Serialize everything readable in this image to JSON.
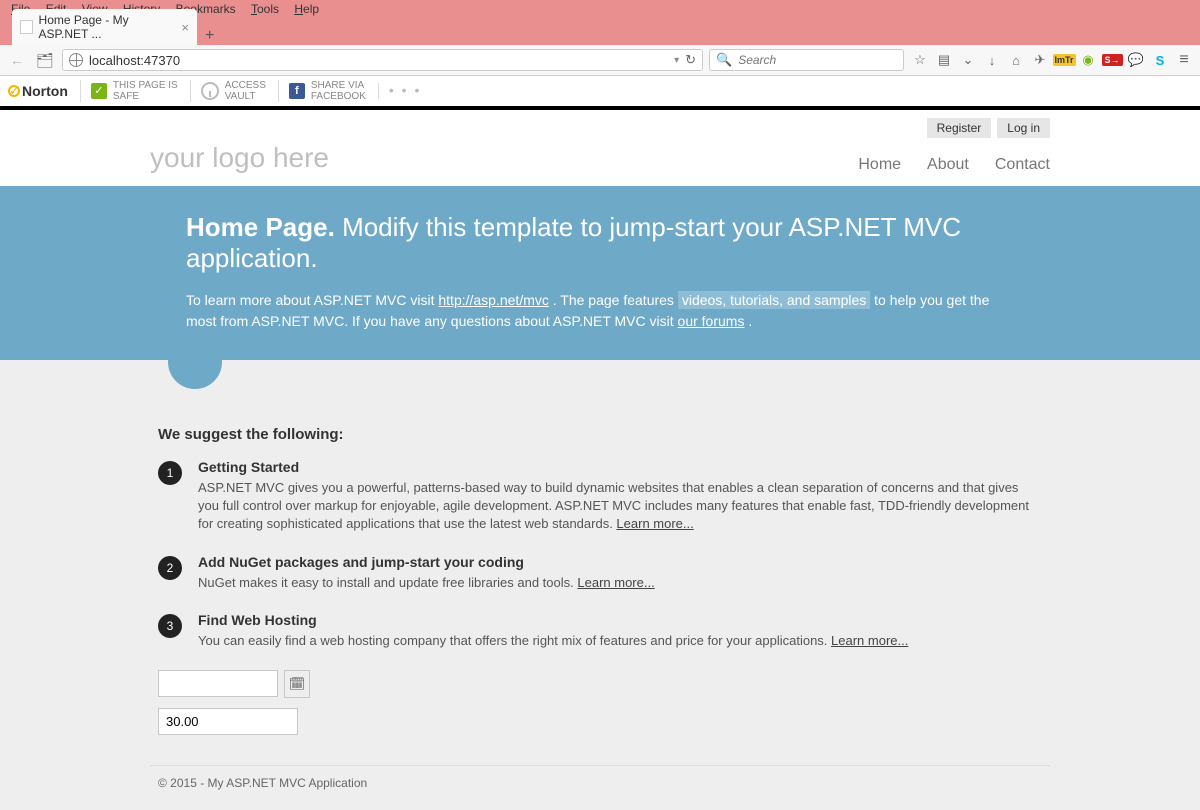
{
  "menubar": {
    "file": "File",
    "edit": "Edit",
    "view": "View",
    "history": "History",
    "bookmarks": "Bookmarks",
    "tools": "Tools",
    "help": "Help"
  },
  "tab": {
    "title": "Home Page - My ASP.NET ..."
  },
  "url": {
    "host": "localhost:",
    "port": "47370"
  },
  "search": {
    "placeholder": "Search"
  },
  "norton": {
    "brand": "Norton",
    "safe_t": "THIS PAGE IS",
    "safe_b": "SAFE",
    "vault_t": "ACCESS",
    "vault_b": "VAULT",
    "fb_t": "SHARE VIA",
    "fb_b": "FACEBOOK"
  },
  "auth": {
    "register": "Register",
    "login": "Log in"
  },
  "logo": "your logo here",
  "nav": {
    "home": "Home",
    "about": "About",
    "contact": "Contact"
  },
  "hero": {
    "title_strong": "Home Page.",
    "title_rest": "Modify this template to jump-start your ASP.NET MVC application.",
    "p1_a": "To learn more about ASP.NET MVC visit ",
    "p1_link1": "http://asp.net/mvc",
    "p1_b": ". The page features ",
    "p1_link2": "videos, tutorials, and samples",
    "p1_c": " to help you get the most from ASP.NET MVC. If you have any questions about ASP.NET MVC visit ",
    "p1_link3": "our forums",
    "p1_d": "."
  },
  "suggest_title": "We suggest the following:",
  "items": [
    {
      "n": "1",
      "h": "Getting Started",
      "p": "ASP.NET MVC gives you a powerful, patterns-based way to build dynamic websites that enables a clean separation of concerns and that gives you full control over markup for enjoyable, agile development. ASP.NET MVC includes many features that enable fast, TDD-friendly development for creating sophisticated applications that use the latest web standards. ",
      "more": "Learn more..."
    },
    {
      "n": "2",
      "h": "Add NuGet packages and jump-start your coding",
      "p": "NuGet makes it easy to install and update free libraries and tools. ",
      "more": "Learn more..."
    },
    {
      "n": "3",
      "h": "Find Web Hosting",
      "p": "You can easily find a web hosting company that offers the right mix of features and price for your applications. ",
      "more": "Learn more..."
    }
  ],
  "num_input": "30.00",
  "footer": "© 2015 - My ASP.NET MVC Application"
}
